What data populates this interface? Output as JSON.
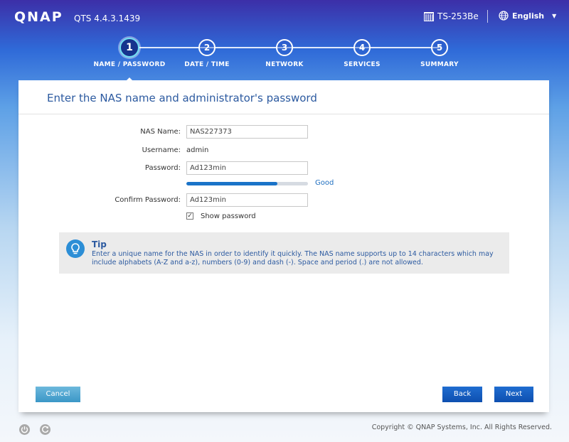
{
  "header": {
    "logo": "QNAP",
    "version": "QTS 4.4.3.1439",
    "device_name": "TS-253Be",
    "language": "English"
  },
  "steps": [
    {
      "number": "1",
      "label": "NAME / PASSWORD",
      "active": true
    },
    {
      "number": "2",
      "label": "DATE / TIME",
      "active": false
    },
    {
      "number": "3",
      "label": "NETWORK",
      "active": false
    },
    {
      "number": "4",
      "label": "SERVICES",
      "active": false
    },
    {
      "number": "5",
      "label": "SUMMARY",
      "active": false
    }
  ],
  "panel": {
    "title": "Enter the NAS name and administrator's password",
    "nas_name_label": "NAS Name:",
    "nas_name_value": "NAS227373",
    "username_label": "Username:",
    "username_value": "admin",
    "password_label": "Password:",
    "password_value": "Ad123min",
    "strength_fraction": 0.75,
    "strength_label": "Good",
    "confirm_label": "Confirm Password:",
    "confirm_value": "Ad123min",
    "show_password_checked": true,
    "show_password_label": "Show password"
  },
  "tip": {
    "title": "Tip",
    "text": "Enter a unique name for the NAS in order to identify it quickly. The NAS name supports up to 14 characters which may include alphabets (A-Z and a-z), numbers (0-9) and dash (-). Space and period (.) are not allowed."
  },
  "buttons": {
    "cancel": "Cancel",
    "back": "Back",
    "next": "Next"
  },
  "footer": {
    "copyright": "Copyright © QNAP Systems, Inc. All Rights Reserved."
  },
  "colors": {
    "accent": "#1a73c8",
    "title_blue": "#2c5aa0"
  }
}
